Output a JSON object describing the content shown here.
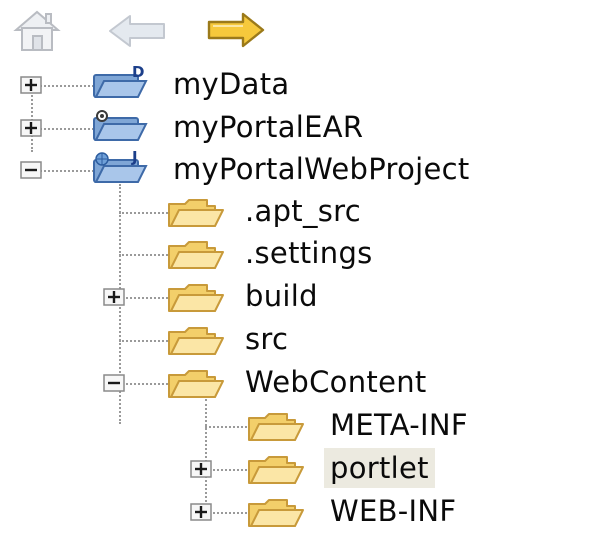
{
  "toolbar": {
    "buttons": [
      {
        "name": "home",
        "icon": "home-icon",
        "enabled": false
      },
      {
        "name": "back",
        "icon": "arrow-left-icon",
        "enabled": false
      },
      {
        "name": "forward",
        "icon": "arrow-right-icon",
        "enabled": true
      }
    ]
  },
  "tree": {
    "items": [
      {
        "label": "myData",
        "depth": 0,
        "expander": "plus",
        "icon": "project-folder-icon",
        "badge": "D"
      },
      {
        "label": "myPortalEAR",
        "depth": 0,
        "expander": "plus",
        "icon": "ear-project-icon"
      },
      {
        "label": "myPortalWebProject",
        "depth": 0,
        "expander": "minus",
        "icon": "web-project-icon",
        "badge": "J"
      },
      {
        "label": ".apt_src",
        "depth": 1,
        "expander": "none",
        "icon": "folder-icon"
      },
      {
        "label": ".settings",
        "depth": 1,
        "expander": "none",
        "icon": "folder-icon"
      },
      {
        "label": "build",
        "depth": 1,
        "expander": "plus",
        "icon": "folder-icon"
      },
      {
        "label": "src",
        "depth": 1,
        "expander": "none",
        "icon": "folder-icon"
      },
      {
        "label": "WebContent",
        "depth": 1,
        "expander": "minus",
        "icon": "folder-icon"
      },
      {
        "label": "META-INF",
        "depth": 2,
        "expander": "none",
        "icon": "folder-icon"
      },
      {
        "label": "portlet",
        "depth": 2,
        "expander": "plus",
        "icon": "folder-icon",
        "selected": true
      },
      {
        "label": "WEB-INF",
        "depth": 2,
        "expander": "plus",
        "icon": "folder-icon"
      }
    ]
  },
  "colors": {
    "arrow_forward_fill": "#f6c93c",
    "arrow_disabled_fill": "#e4e9ef",
    "folder_fill": "#f7d97a",
    "folder_stroke": "#c9a14a",
    "selection_bg": "#eceae0",
    "tree_lines": "#9a9a9a"
  }
}
